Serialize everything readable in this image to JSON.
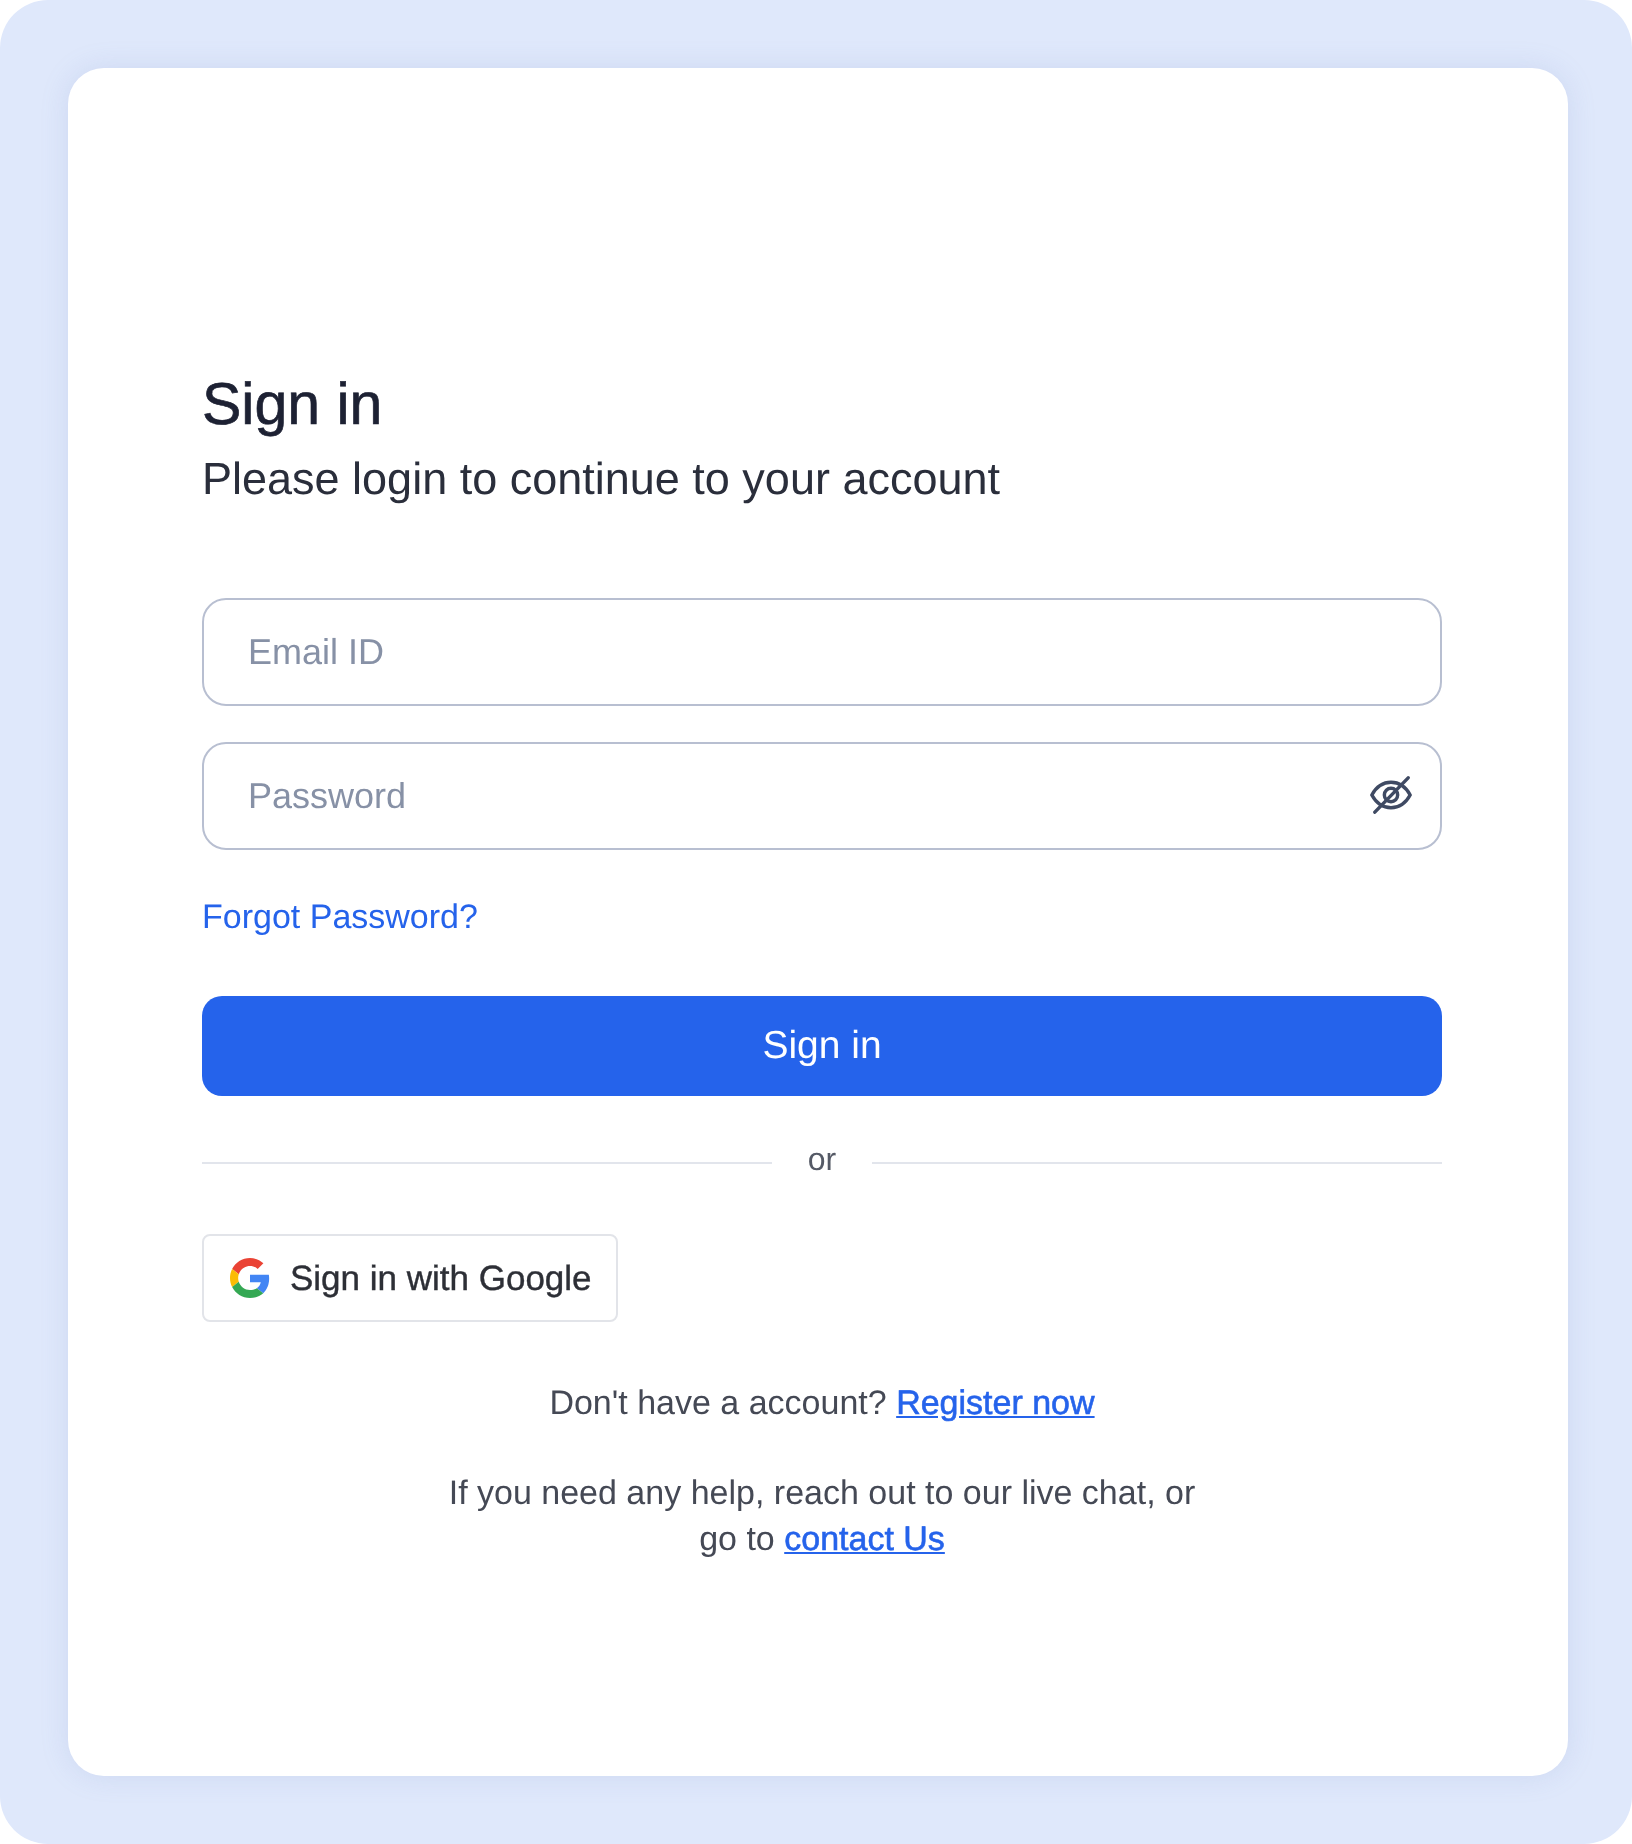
{
  "heading": "Sign in",
  "subheading": "Please login to continue to your account",
  "fields": [
    {
      "kind": "text",
      "placeholder": "Email ID"
    },
    {
      "kind": "password",
      "placeholder": "Password"
    }
  ],
  "forgot_link": "Forgot Password?",
  "primary_button": "Sign in",
  "divider": "or",
  "google_button": "Sign in with Google",
  "register": {
    "text": "Don't have a account?",
    "link": "Register now"
  },
  "help": {
    "text": "If you need any help, reach out to our live chat, or go to",
    "link": "contact Us"
  }
}
